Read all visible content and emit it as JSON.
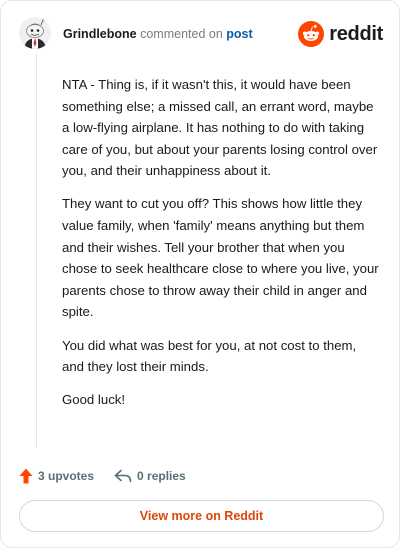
{
  "comment": {
    "username": "Grindlebone",
    "verb": "commented on",
    "link_text": "post",
    "brand": "reddit",
    "paragraphs": [
      "NTA - Thing is, if it wasn't this, it would have been something else; a missed call, an errant word, maybe a low-flying airplane. It has nothing to do with taking care of you, but about your parents losing control over you, and their unhappiness about it.",
      "They want to cut you off? This shows how little they value family, when 'family' means anything but them and their wishes. Tell your brother that when you chose to seek healthcare close to where you live, your parents chose to throw away their child in anger and spite.",
      "You did what was best for you, at not cost to them, and they lost their minds.",
      "Good luck!"
    ]
  },
  "actions": {
    "upvotes": "3 upvotes",
    "replies": "0 replies"
  },
  "cta": {
    "label": "View more on Reddit"
  },
  "colors": {
    "upvote": "#ff4500",
    "link": "#0a5ca8",
    "cta": "#e0450a",
    "brand_orange": "#ff4500"
  },
  "icons": {
    "avatar": "snoo-avatar",
    "logo": "reddit-logo-icon",
    "upvote": "upvote-arrow-icon",
    "reply": "reply-arrow-icon"
  }
}
